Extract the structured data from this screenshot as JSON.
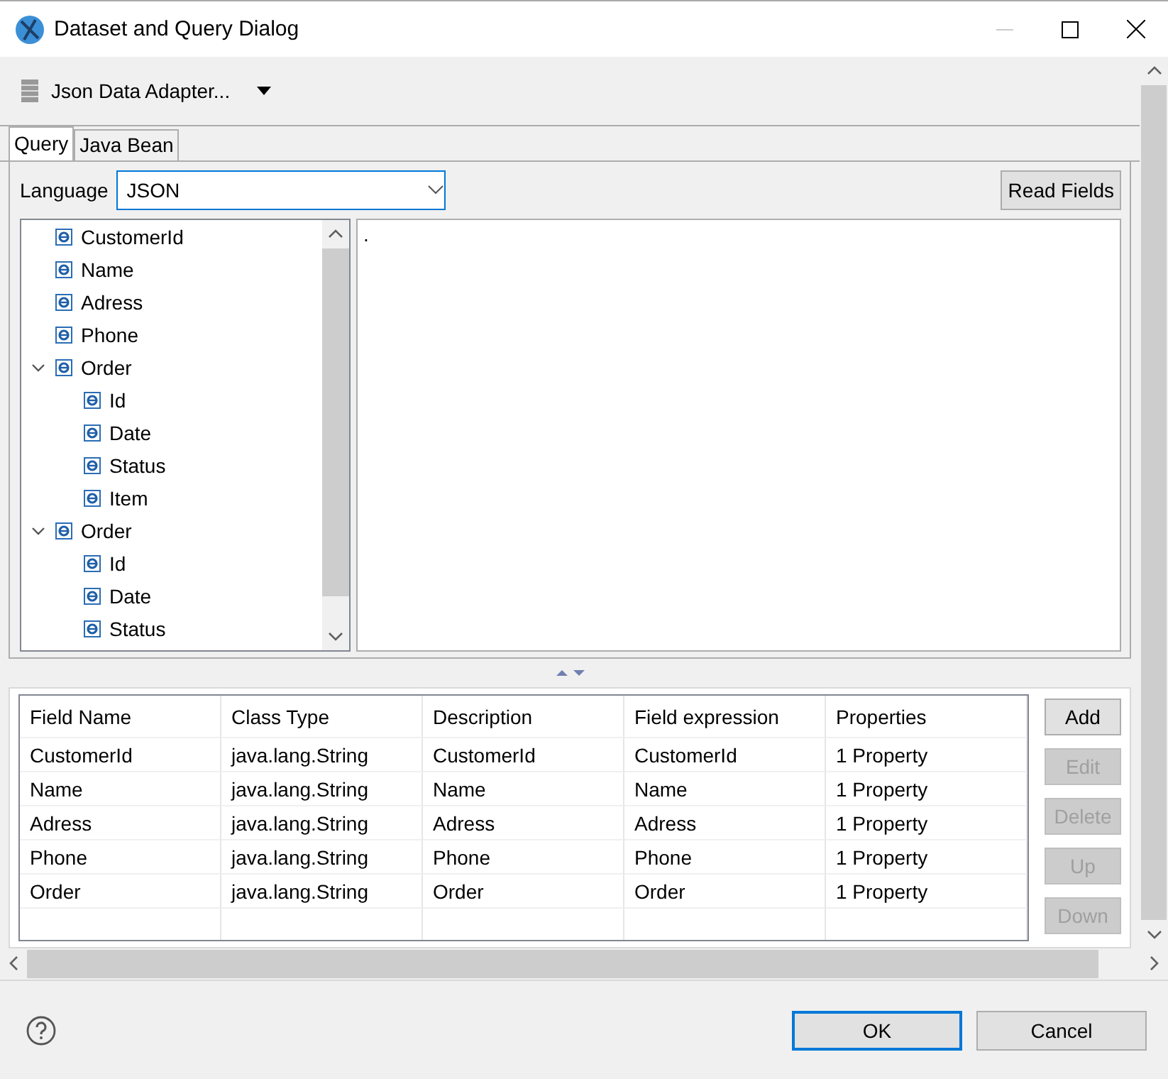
{
  "window": {
    "title": "Dataset and Query Dialog"
  },
  "adapter": {
    "label": "Json Data Adapter..."
  },
  "tabs": [
    {
      "label": "Query",
      "selected": true
    },
    {
      "label": "Java Bean",
      "selected": false
    }
  ],
  "language": {
    "label": "Language",
    "value": "JSON"
  },
  "read_fields_button": "Read Fields",
  "tree": [
    {
      "label": "CustomerId"
    },
    {
      "label": "Name"
    },
    {
      "label": "Adress"
    },
    {
      "label": "Phone"
    },
    {
      "label": "Order",
      "expanded": true,
      "children": [
        {
          "label": "Id"
        },
        {
          "label": "Date"
        },
        {
          "label": "Status"
        },
        {
          "label": "Item"
        }
      ]
    },
    {
      "label": "Order",
      "expanded": true,
      "children": [
        {
          "label": "Id"
        },
        {
          "label": "Date"
        },
        {
          "label": "Status"
        }
      ]
    }
  ],
  "query_text": ".",
  "table": {
    "columns": [
      "Field Name",
      "Class Type",
      "Description",
      "Field expression",
      "Properties"
    ],
    "rows": [
      [
        "CustomerId",
        "java.lang.String",
        "CustomerId",
        "CustomerId",
        "1 Property"
      ],
      [
        "Name",
        "java.lang.String",
        "Name",
        "Name",
        "1 Property"
      ],
      [
        "Adress",
        "java.lang.String",
        "Adress",
        "Adress",
        "1 Property"
      ],
      [
        "Phone",
        "java.lang.String",
        "Phone",
        "Phone",
        "1 Property"
      ],
      [
        "Order",
        "java.lang.String",
        "Order",
        "Order",
        "1 Property"
      ]
    ]
  },
  "side_buttons": [
    {
      "label": "Add",
      "disabled": false
    },
    {
      "label": "Edit",
      "disabled": true
    },
    {
      "label": "Delete",
      "disabled": true
    },
    {
      "label": "Up",
      "disabled": true
    },
    {
      "label": "Down",
      "disabled": true
    }
  ],
  "footer_buttons": [
    {
      "label": "OK",
      "kind": "default"
    },
    {
      "label": "Cancel",
      "kind": "normal"
    }
  ]
}
